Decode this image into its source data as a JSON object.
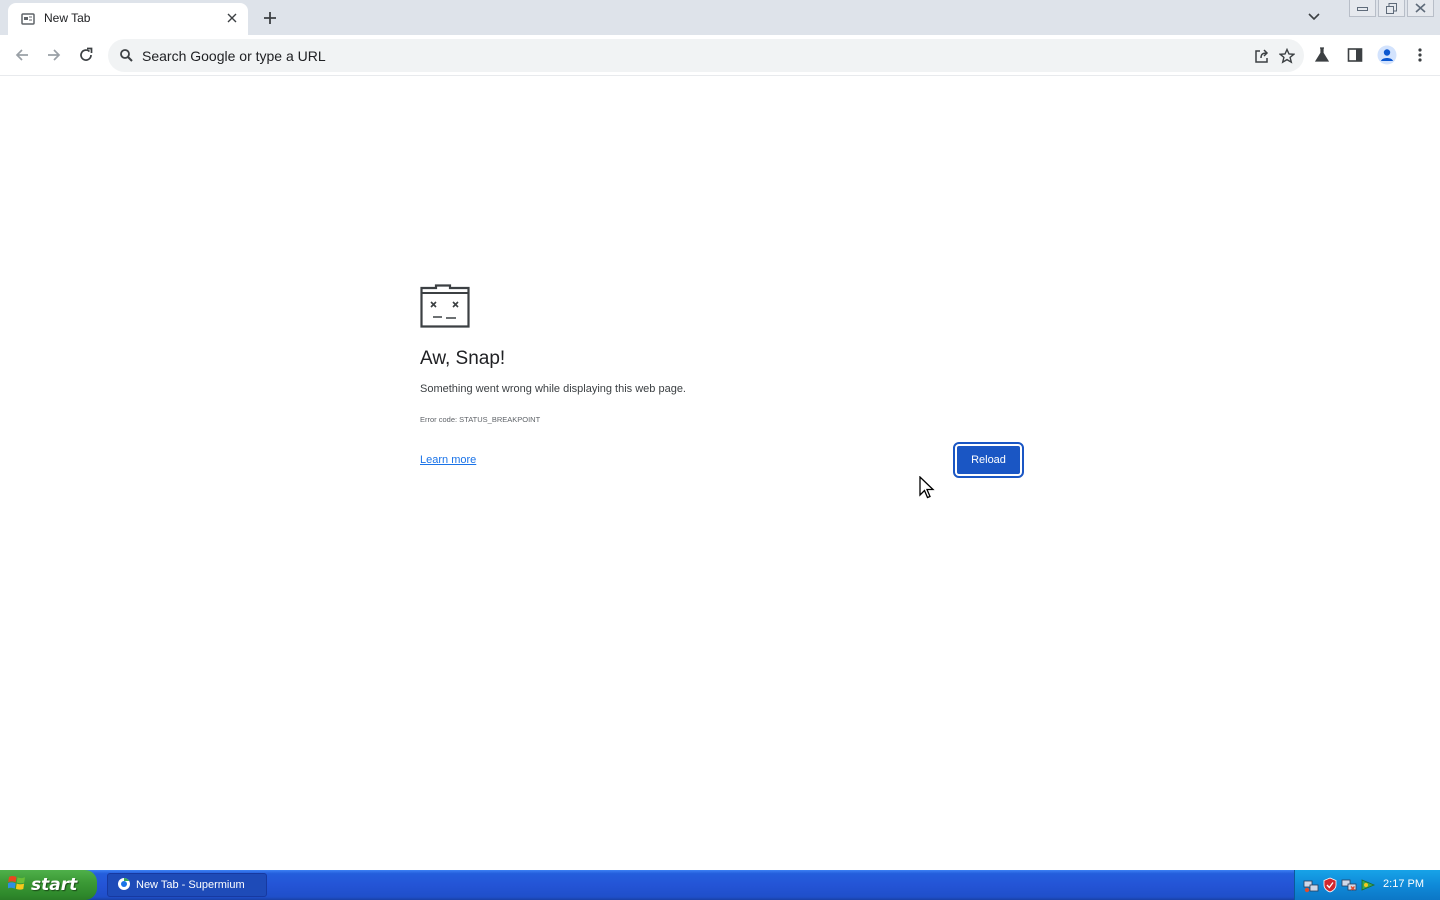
{
  "browser": {
    "tab": {
      "title": "New Tab"
    },
    "omnibox": {
      "placeholder": "Search Google or type a URL"
    }
  },
  "error_page": {
    "title": "Aw, Snap!",
    "description": "Something went wrong while displaying this web page.",
    "error_code": "Error code: STATUS_BREAKPOINT",
    "learn_more": "Learn more",
    "reload": "Reload"
  },
  "taskbar": {
    "start_label": "start",
    "task_item": "New Tab - Supermium",
    "clock": "2:17 PM"
  },
  "colors": {
    "tabstrip": "#dee3ea",
    "reload_button": "#1a56c4",
    "link": "#1a73e8",
    "taskbar": "#245edc",
    "start_button": "#3c9a36"
  },
  "icons": [
    "tab-favicon-icon",
    "close-icon",
    "plus-icon",
    "chevron-down-icon",
    "minimize-icon",
    "restore-icon",
    "close-window-icon",
    "back-icon",
    "forward-icon",
    "reload-icon",
    "search-icon",
    "share-icon",
    "star-icon",
    "labs-icon",
    "side-panel-icon",
    "profile-icon",
    "menu-icon",
    "sad-tab-icon",
    "windows-logo-icon",
    "supermium-icon"
  ]
}
